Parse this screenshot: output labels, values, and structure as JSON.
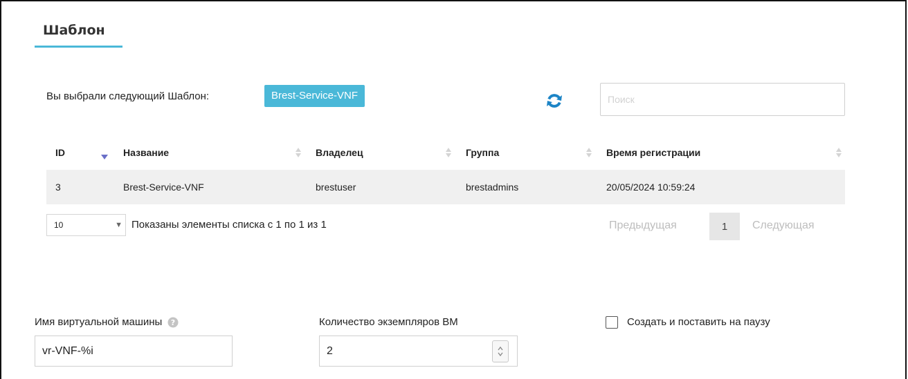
{
  "tab": {
    "title": "Шаблон"
  },
  "selection": {
    "label": "Вы выбрали следующий Шаблон:",
    "badge": "Brest-Service-VNF"
  },
  "toolbar": {
    "refresh_icon": "refresh-icon"
  },
  "search": {
    "placeholder": "Поиск",
    "value": ""
  },
  "table": {
    "columns": [
      "ID",
      "Название",
      "Владелец",
      "Группа",
      "Время регистрации"
    ],
    "sorted_column": "ID",
    "sort_direction": "desc",
    "rows": [
      [
        "3",
        "Brest-Service-VNF",
        "brestuser",
        "brestadmins",
        "20/05/2024 10:59:24"
      ]
    ]
  },
  "pagination": {
    "page_size": "10",
    "info": "Показаны элементы списка с 1 по 1 из 1",
    "prev_label": "Предыдущая",
    "current_page": "1",
    "next_label": "Следующая"
  },
  "form": {
    "vm_name_label": "Имя виртуальной машины",
    "vm_name_value": "vr-VNF-%i",
    "instances_label": "Количество экземпляров ВМ",
    "instances_value": "2",
    "hold_label": "Создать и поставить на паузу",
    "hold_checked": false
  },
  "colors": {
    "accent": "#4ab8d8",
    "refresh_icon": "#1c84c6",
    "row_bg": "#f0f0f0"
  }
}
